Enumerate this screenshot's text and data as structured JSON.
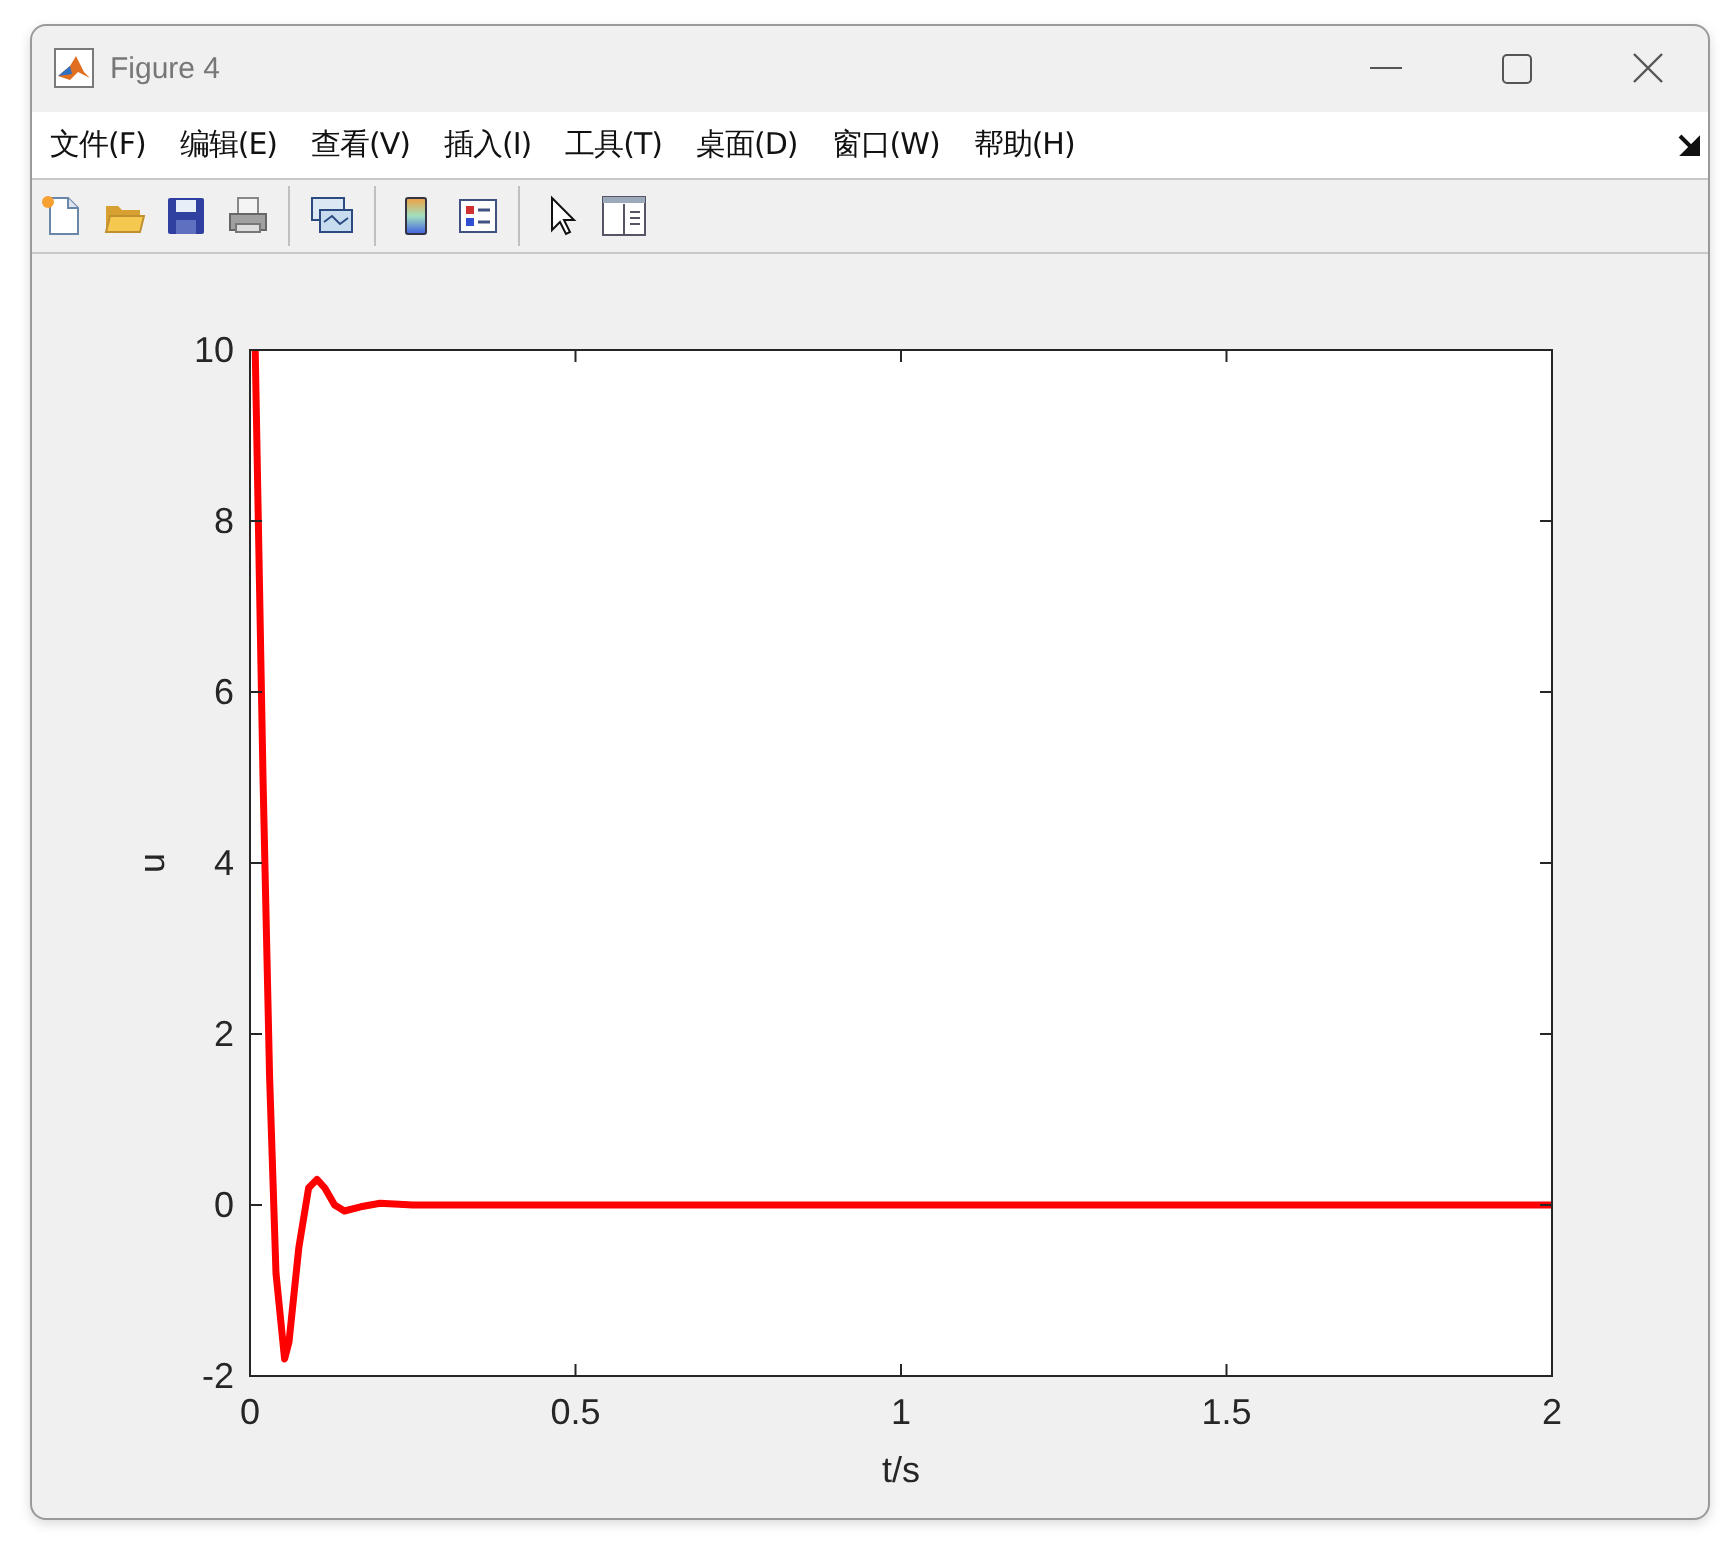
{
  "window": {
    "title": "Figure 4"
  },
  "menu": [
    "文件(F)",
    "编辑(E)",
    "查看(V)",
    "插入(I)",
    "工具(T)",
    "桌面(D)",
    "窗口(W)",
    "帮助(H)"
  ],
  "toolbar": [
    {
      "kind": "new"
    },
    {
      "kind": "open"
    },
    {
      "kind": "save"
    },
    {
      "kind": "print"
    },
    {
      "kind": "separator"
    },
    {
      "kind": "link"
    },
    {
      "kind": "separator"
    },
    {
      "kind": "colorbar"
    },
    {
      "kind": "legend"
    },
    {
      "kind": "separator"
    },
    {
      "kind": "pointer"
    },
    {
      "kind": "inspector"
    }
  ],
  "chart_data": {
    "type": "line",
    "xlabel": "t/s",
    "ylabel": "u",
    "xlim": [
      0,
      2
    ],
    "ylim": [
      -2,
      10
    ],
    "xticks": [
      0,
      {
        "value": 0.5,
        "label": "0.5"
      },
      1,
      {
        "value": 1.5,
        "label": "1.5"
      },
      2
    ],
    "yticks": [
      -2,
      0,
      2,
      4,
      6,
      8,
      10
    ],
    "x": [
      0.008,
      0.02,
      0.03,
      0.04,
      0.053,
      0.06,
      0.075,
      0.09,
      0.103,
      0.115,
      0.13,
      0.145,
      0.17,
      0.2,
      0.25,
      2
    ],
    "series": [
      {
        "color": "#ff0000",
        "values": [
          10,
          5,
          1.5,
          -0.8,
          -1.8,
          -1.6,
          -0.5,
          0.2,
          0.3,
          0.2,
          0,
          -0.07,
          -0.02,
          0.02,
          0,
          0
        ]
      }
    ]
  }
}
